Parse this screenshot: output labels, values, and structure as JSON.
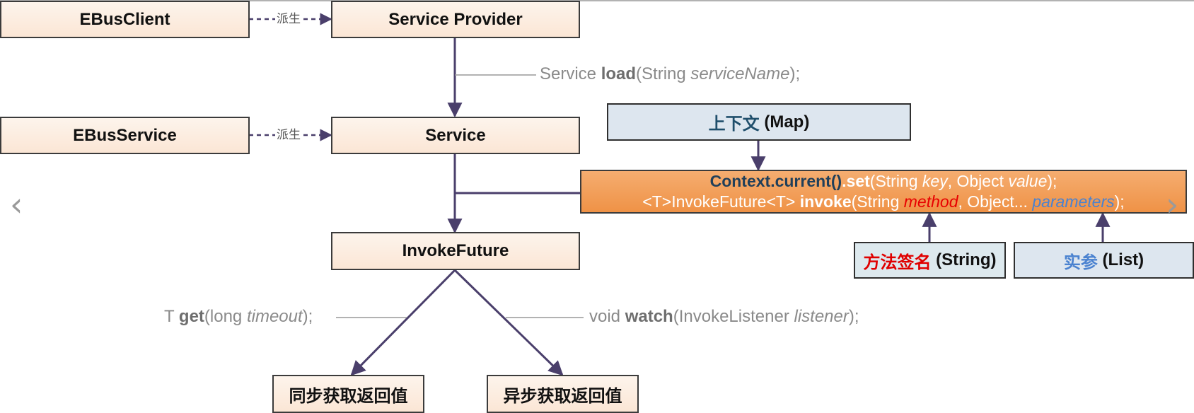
{
  "nodes": {
    "ebus_client": "EBusClient",
    "service_provider": "Service Provider",
    "ebus_service": "EBusService",
    "service": "Service",
    "invoke_future": "InvokeFuture",
    "sync_result": "同步获取返回值",
    "async_result": "异步获取返回值"
  },
  "derive_labels": {
    "client_to_provider": "派生",
    "service_to_service": "派生"
  },
  "context_box": {
    "cn": "上下文",
    "type": "(Map)"
  },
  "method_sig_box": {
    "cn": "方法签名",
    "type": "(String)"
  },
  "args_box": {
    "cn": "实参",
    "type": "(List)"
  },
  "code_box": {
    "line1": {
      "ctx": "Context.current()",
      "set": ".set",
      "p1": "(String ",
      "key": "key",
      "p2": ", Object ",
      "value": "value",
      "p3": ");"
    },
    "line2": {
      "p1": "<T>InvokeFuture<T> ",
      "invoke": "invoke",
      "p2": "(String ",
      "method": "method",
      "p3": ", Object... ",
      "parameters": "parameters",
      "p4": ");"
    }
  },
  "edge_labels": {
    "load": {
      "pre": "Service ",
      "name": "load",
      "args_pre": "(String ",
      "arg": "serviceName",
      "args_post": ");"
    },
    "get": {
      "pre": "T ",
      "name": "get",
      "args_pre": "(long ",
      "arg": "timeout",
      "args_post": ");"
    },
    "watch": {
      "pre": "void ",
      "name": "watch",
      "args_pre": "(InvokeListener ",
      "arg": "listener",
      "args_post": ");"
    }
  },
  "nav": {
    "prev": "‹",
    "next": "›"
  },
  "colors": {
    "line": "#4a3f6b",
    "box_border": "#3b3b3b",
    "peach_fill": "#fbe6d5",
    "orange_fill": "#f09a50",
    "blue_fill": "#dde6ef"
  }
}
